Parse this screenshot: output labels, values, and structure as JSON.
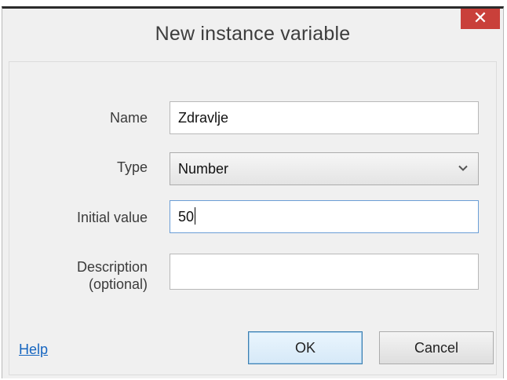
{
  "dialog": {
    "title": "New instance variable",
    "close_symbol": "✕"
  },
  "form": {
    "name_label": "Name",
    "name_value": "Zdravlje",
    "type_label": "Type",
    "type_value": "Number",
    "initial_value_label": "Initial value",
    "initial_value_value": "50",
    "description_label_line1": "Description",
    "description_label_line2": "(optional)",
    "description_value": ""
  },
  "footer": {
    "help_label": "Help",
    "ok_label": "OK",
    "cancel_label": "Cancel"
  },
  "colors": {
    "close_button": "#c9403a",
    "link": "#1565c0",
    "focus_border": "#6b9ed6"
  },
  "icons": {
    "close": "close-icon",
    "dropdown": "chevron-down-icon"
  }
}
